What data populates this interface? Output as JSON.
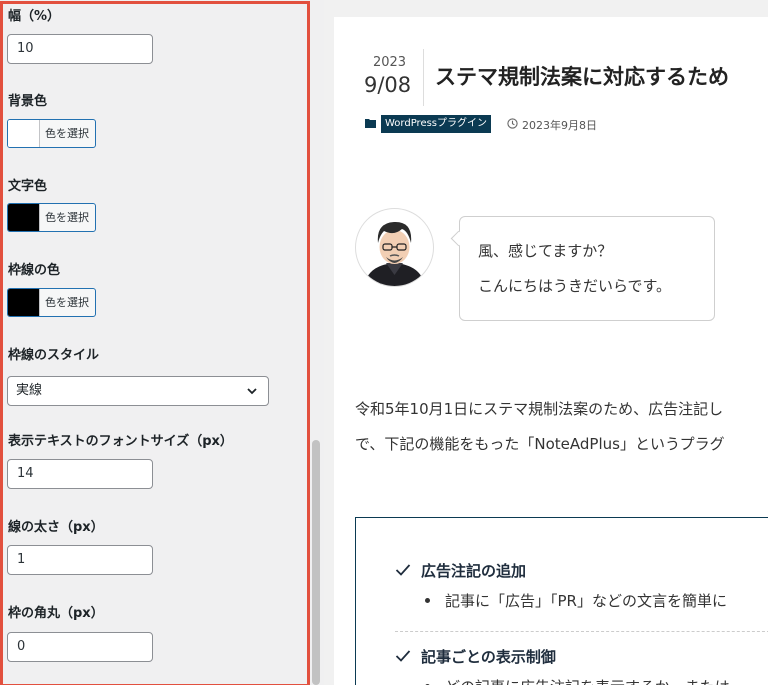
{
  "settings_panel": {
    "width": {
      "label": "幅（%）",
      "value": "10"
    },
    "background_color": {
      "label": "背景色",
      "button_label": "色を選択",
      "swatch_color": "#ffffff"
    },
    "text_color": {
      "label": "文字色",
      "button_label": "色を選択",
      "swatch_color": "#000000"
    },
    "border_color": {
      "label": "枠線の色",
      "button_label": "色を選択",
      "swatch_color": "#000000"
    },
    "border_style": {
      "label": "枠線のスタイル",
      "selected": "実線"
    },
    "font_size": {
      "label": "表示テキストのフォントサイズ（px）",
      "value": "14"
    },
    "line_width": {
      "label": "線の太さ（px）",
      "value": "1"
    },
    "border_radius": {
      "label": "枠の角丸（px）",
      "value": "0"
    },
    "highlight_color": "#e2503e"
  },
  "article": {
    "date_year": "2023",
    "date_month_day": "9/08",
    "title": "ステマ規制法案に対応するため",
    "category": "WordPressプラグイン",
    "published": "2023年9月8日",
    "speech": {
      "line1": "風、感じてますか？",
      "line2": "こんにちはうきだいらです。"
    },
    "body": {
      "line1": "令和5年10月1日にステマ規制法案のため、広告注記し",
      "line2": "で、下記の機能をもった「NoteAdPlus」というプラグ"
    },
    "features": [
      {
        "title": "広告注記の追加",
        "text": "記事に「広告」「PR」などの文言を簡単に"
      },
      {
        "title": "記事ごとの表示制御",
        "text": "どの記事に広告注記を表示するか、または"
      }
    ],
    "accent_color": "#0b3a52"
  }
}
